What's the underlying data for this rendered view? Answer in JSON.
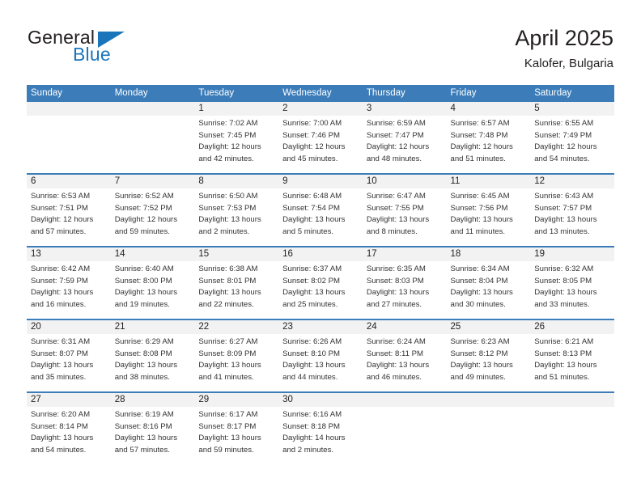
{
  "brand": {
    "name_top": "General",
    "name_bottom": "Blue",
    "color_dark": "#231f20",
    "color_blue": "#1b75bb"
  },
  "header": {
    "title": "April 2025",
    "subtitle": "Kalofer, Bulgaria"
  },
  "theme": {
    "header_blue": "#3b7cb9",
    "band_gray": "#f2f2f2",
    "text": "#231f20"
  },
  "calendar": {
    "day_headers": [
      "Sunday",
      "Monday",
      "Tuesday",
      "Wednesday",
      "Thursday",
      "Friday",
      "Saturday"
    ],
    "weeks": [
      [
        {
          "day": "",
          "sunrise": "",
          "sunset": "",
          "daylight_line1": "",
          "daylight_line2": ""
        },
        {
          "day": "",
          "sunrise": "",
          "sunset": "",
          "daylight_line1": "",
          "daylight_line2": ""
        },
        {
          "day": "1",
          "sunrise": "Sunrise: 7:02 AM",
          "sunset": "Sunset: 7:45 PM",
          "daylight_line1": "Daylight: 12 hours",
          "daylight_line2": "and 42 minutes."
        },
        {
          "day": "2",
          "sunrise": "Sunrise: 7:00 AM",
          "sunset": "Sunset: 7:46 PM",
          "daylight_line1": "Daylight: 12 hours",
          "daylight_line2": "and 45 minutes."
        },
        {
          "day": "3",
          "sunrise": "Sunrise: 6:59 AM",
          "sunset": "Sunset: 7:47 PM",
          "daylight_line1": "Daylight: 12 hours",
          "daylight_line2": "and 48 minutes."
        },
        {
          "day": "4",
          "sunrise": "Sunrise: 6:57 AM",
          "sunset": "Sunset: 7:48 PM",
          "daylight_line1": "Daylight: 12 hours",
          "daylight_line2": "and 51 minutes."
        },
        {
          "day": "5",
          "sunrise": "Sunrise: 6:55 AM",
          "sunset": "Sunset: 7:49 PM",
          "daylight_line1": "Daylight: 12 hours",
          "daylight_line2": "and 54 minutes."
        }
      ],
      [
        {
          "day": "6",
          "sunrise": "Sunrise: 6:53 AM",
          "sunset": "Sunset: 7:51 PM",
          "daylight_line1": "Daylight: 12 hours",
          "daylight_line2": "and 57 minutes."
        },
        {
          "day": "7",
          "sunrise": "Sunrise: 6:52 AM",
          "sunset": "Sunset: 7:52 PM",
          "daylight_line1": "Daylight: 12 hours",
          "daylight_line2": "and 59 minutes."
        },
        {
          "day": "8",
          "sunrise": "Sunrise: 6:50 AM",
          "sunset": "Sunset: 7:53 PM",
          "daylight_line1": "Daylight: 13 hours",
          "daylight_line2": "and 2 minutes."
        },
        {
          "day": "9",
          "sunrise": "Sunrise: 6:48 AM",
          "sunset": "Sunset: 7:54 PM",
          "daylight_line1": "Daylight: 13 hours",
          "daylight_line2": "and 5 minutes."
        },
        {
          "day": "10",
          "sunrise": "Sunrise: 6:47 AM",
          "sunset": "Sunset: 7:55 PM",
          "daylight_line1": "Daylight: 13 hours",
          "daylight_line2": "and 8 minutes."
        },
        {
          "day": "11",
          "sunrise": "Sunrise: 6:45 AM",
          "sunset": "Sunset: 7:56 PM",
          "daylight_line1": "Daylight: 13 hours",
          "daylight_line2": "and 11 minutes."
        },
        {
          "day": "12",
          "sunrise": "Sunrise: 6:43 AM",
          "sunset": "Sunset: 7:57 PM",
          "daylight_line1": "Daylight: 13 hours",
          "daylight_line2": "and 13 minutes."
        }
      ],
      [
        {
          "day": "13",
          "sunrise": "Sunrise: 6:42 AM",
          "sunset": "Sunset: 7:59 PM",
          "daylight_line1": "Daylight: 13 hours",
          "daylight_line2": "and 16 minutes."
        },
        {
          "day": "14",
          "sunrise": "Sunrise: 6:40 AM",
          "sunset": "Sunset: 8:00 PM",
          "daylight_line1": "Daylight: 13 hours",
          "daylight_line2": "and 19 minutes."
        },
        {
          "day": "15",
          "sunrise": "Sunrise: 6:38 AM",
          "sunset": "Sunset: 8:01 PM",
          "daylight_line1": "Daylight: 13 hours",
          "daylight_line2": "and 22 minutes."
        },
        {
          "day": "16",
          "sunrise": "Sunrise: 6:37 AM",
          "sunset": "Sunset: 8:02 PM",
          "daylight_line1": "Daylight: 13 hours",
          "daylight_line2": "and 25 minutes."
        },
        {
          "day": "17",
          "sunrise": "Sunrise: 6:35 AM",
          "sunset": "Sunset: 8:03 PM",
          "daylight_line1": "Daylight: 13 hours",
          "daylight_line2": "and 27 minutes."
        },
        {
          "day": "18",
          "sunrise": "Sunrise: 6:34 AM",
          "sunset": "Sunset: 8:04 PM",
          "daylight_line1": "Daylight: 13 hours",
          "daylight_line2": "and 30 minutes."
        },
        {
          "day": "19",
          "sunrise": "Sunrise: 6:32 AM",
          "sunset": "Sunset: 8:05 PM",
          "daylight_line1": "Daylight: 13 hours",
          "daylight_line2": "and 33 minutes."
        }
      ],
      [
        {
          "day": "20",
          "sunrise": "Sunrise: 6:31 AM",
          "sunset": "Sunset: 8:07 PM",
          "daylight_line1": "Daylight: 13 hours",
          "daylight_line2": "and 35 minutes."
        },
        {
          "day": "21",
          "sunrise": "Sunrise: 6:29 AM",
          "sunset": "Sunset: 8:08 PM",
          "daylight_line1": "Daylight: 13 hours",
          "daylight_line2": "and 38 minutes."
        },
        {
          "day": "22",
          "sunrise": "Sunrise: 6:27 AM",
          "sunset": "Sunset: 8:09 PM",
          "daylight_line1": "Daylight: 13 hours",
          "daylight_line2": "and 41 minutes."
        },
        {
          "day": "23",
          "sunrise": "Sunrise: 6:26 AM",
          "sunset": "Sunset: 8:10 PM",
          "daylight_line1": "Daylight: 13 hours",
          "daylight_line2": "and 44 minutes."
        },
        {
          "day": "24",
          "sunrise": "Sunrise: 6:24 AM",
          "sunset": "Sunset: 8:11 PM",
          "daylight_line1": "Daylight: 13 hours",
          "daylight_line2": "and 46 minutes."
        },
        {
          "day": "25",
          "sunrise": "Sunrise: 6:23 AM",
          "sunset": "Sunset: 8:12 PM",
          "daylight_line1": "Daylight: 13 hours",
          "daylight_line2": "and 49 minutes."
        },
        {
          "day": "26",
          "sunrise": "Sunrise: 6:21 AM",
          "sunset": "Sunset: 8:13 PM",
          "daylight_line1": "Daylight: 13 hours",
          "daylight_line2": "and 51 minutes."
        }
      ],
      [
        {
          "day": "27",
          "sunrise": "Sunrise: 6:20 AM",
          "sunset": "Sunset: 8:14 PM",
          "daylight_line1": "Daylight: 13 hours",
          "daylight_line2": "and 54 minutes."
        },
        {
          "day": "28",
          "sunrise": "Sunrise: 6:19 AM",
          "sunset": "Sunset: 8:16 PM",
          "daylight_line1": "Daylight: 13 hours",
          "daylight_line2": "and 57 minutes."
        },
        {
          "day": "29",
          "sunrise": "Sunrise: 6:17 AM",
          "sunset": "Sunset: 8:17 PM",
          "daylight_line1": "Daylight: 13 hours",
          "daylight_line2": "and 59 minutes."
        },
        {
          "day": "30",
          "sunrise": "Sunrise: 6:16 AM",
          "sunset": "Sunset: 8:18 PM",
          "daylight_line1": "Daylight: 14 hours",
          "daylight_line2": "and 2 minutes."
        },
        {
          "day": "",
          "sunrise": "",
          "sunset": "",
          "daylight_line1": "",
          "daylight_line2": ""
        },
        {
          "day": "",
          "sunrise": "",
          "sunset": "",
          "daylight_line1": "",
          "daylight_line2": ""
        },
        {
          "day": "",
          "sunrise": "",
          "sunset": "",
          "daylight_line1": "",
          "daylight_line2": ""
        }
      ]
    ]
  }
}
